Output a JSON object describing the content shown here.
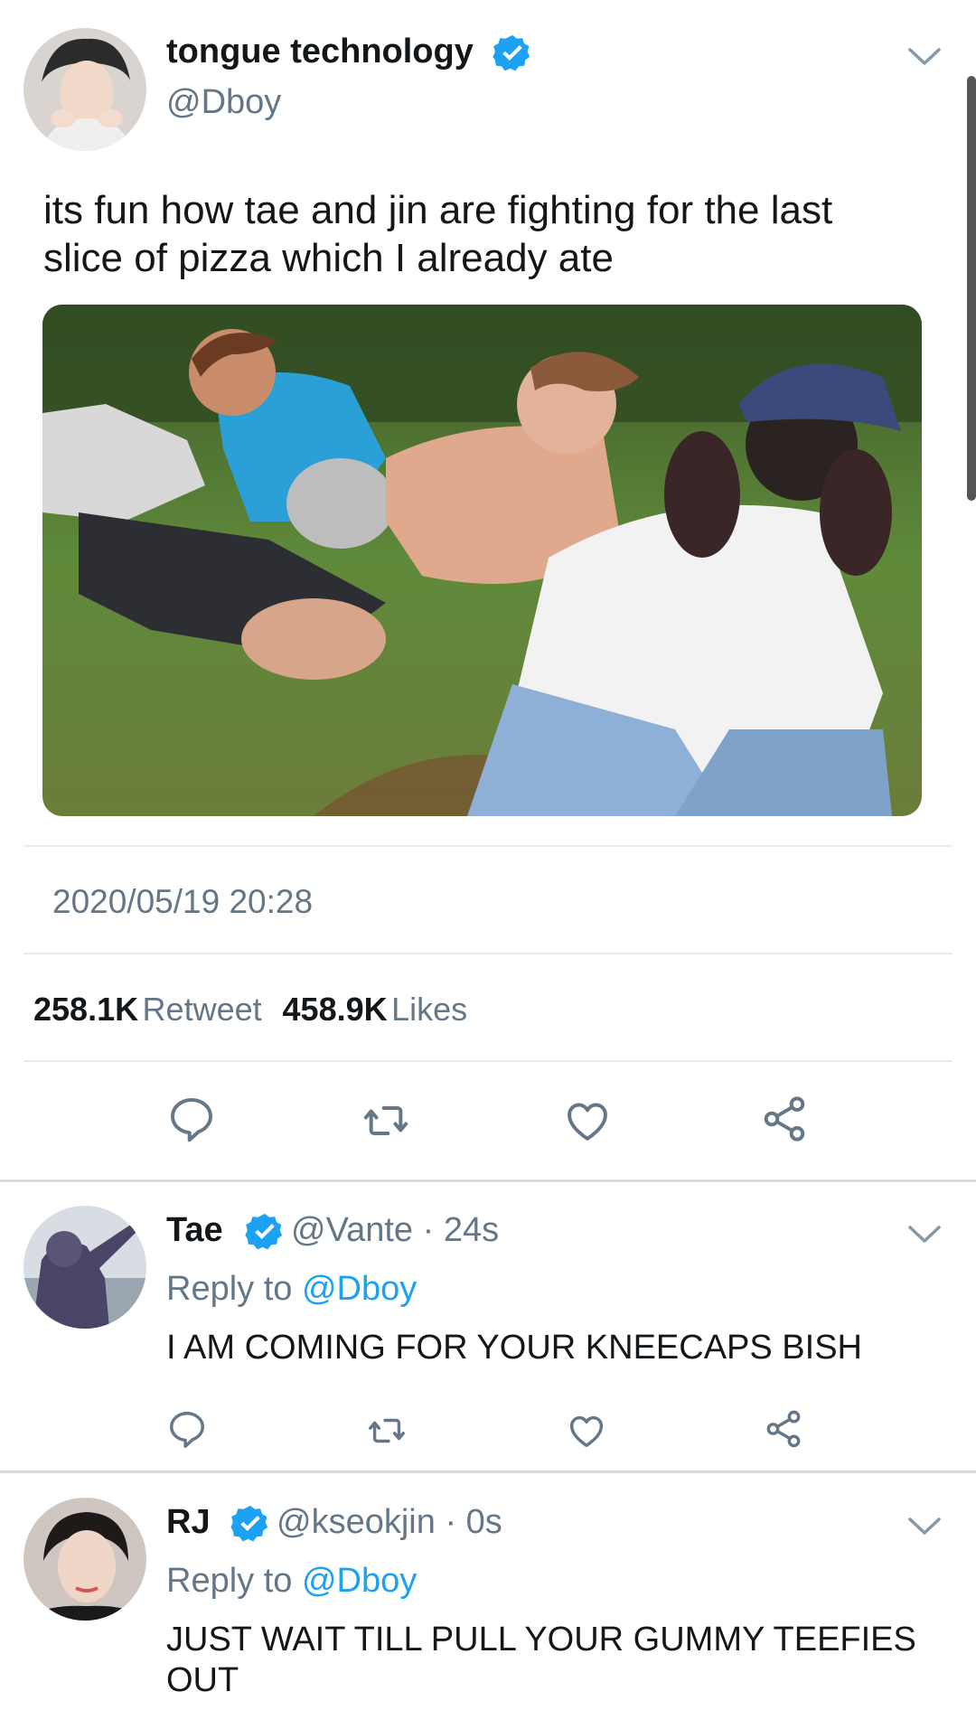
{
  "main_tweet": {
    "author_name": "tongue technology",
    "handle": "@Dboy",
    "text": "its fun how tae and jin are fighting for the last slice of pizza which I already ate",
    "timestamp": "2020/05/19 20:28",
    "retweets_count": "258.1K",
    "retweets_label": "Retweet",
    "likes_count": "458.9K",
    "likes_label": "Likes",
    "avatar_icon": "user-avatar",
    "verified_icon": "verified-badge-icon",
    "media_icon": "photo"
  },
  "actions": {
    "reply_icon": "reply-icon",
    "retweet_icon": "retweet-icon",
    "like_icon": "heart-icon",
    "share_icon": "share-icon"
  },
  "replies": [
    {
      "name": "Tae",
      "handle": "@Vante",
      "time": "· 24s",
      "reply_to_label": "Reply to",
      "reply_to_handle": "@Dboy",
      "text": "I AM COMING FOR YOUR KNEECAPS BISH"
    },
    {
      "name": "RJ",
      "handle": "@kseokjin",
      "time": "· 0s",
      "reply_to_label": "Reply to",
      "reply_to_handle": "@Dboy",
      "text": "JUST WAIT TILL PULL YOUR GUMMY TEEFIES OUT"
    }
  ],
  "colors": {
    "accent": "#1da1f2",
    "secondary_text": "#657786",
    "primary_text": "#14171a",
    "divider": "#e6ecf0"
  }
}
